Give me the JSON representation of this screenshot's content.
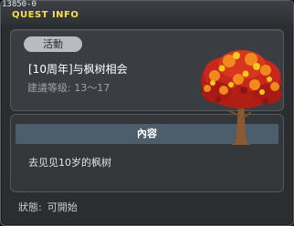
{
  "window": {
    "quest_id": "13850-0",
    "title": "QUEST INFO"
  },
  "quest": {
    "tag": "活動",
    "name": "[10周年]与枫树相会",
    "level_requirement": "建議等级: 13～17"
  },
  "content": {
    "header": "內容",
    "description": "去见见10岁的枫树"
  },
  "status": {
    "label": "狀態:",
    "value": "可開始"
  },
  "icons": {
    "illustration": "maple-tree-icon"
  },
  "colors": {
    "title": "#f5e04a",
    "content_header_bg": "#4c5e6b",
    "leaf_red": "#c8281c",
    "leaf_orange": "#f08a1e",
    "leaf_yellow": "#f5c81e"
  }
}
